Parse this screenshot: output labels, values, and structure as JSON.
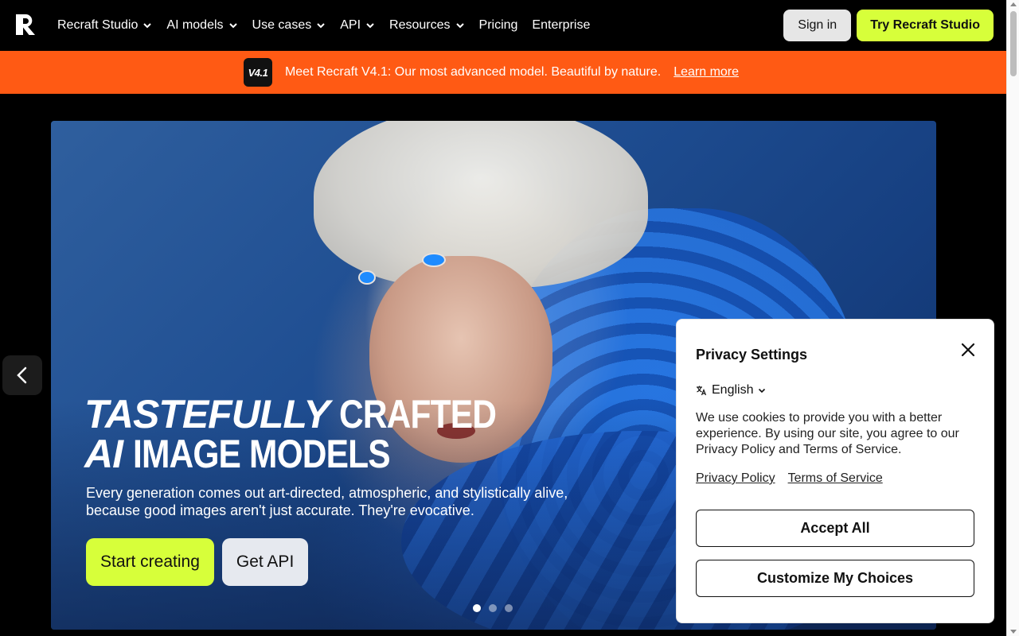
{
  "nav": {
    "items": [
      {
        "label": "Recraft Studio",
        "has_dropdown": true
      },
      {
        "label": "AI models",
        "has_dropdown": true
      },
      {
        "label": "Use cases",
        "has_dropdown": true
      },
      {
        "label": "API",
        "has_dropdown": true
      },
      {
        "label": "Resources",
        "has_dropdown": true
      },
      {
        "label": "Pricing",
        "has_dropdown": false
      },
      {
        "label": "Enterprise",
        "has_dropdown": false
      }
    ],
    "sign_in": "Sign in",
    "try_button": "Try Recraft Studio",
    "logo_icon": "recraft-logo-icon"
  },
  "banner": {
    "badge": "V4.1",
    "text": "Meet Recraft V4.1: Our most advanced model. Beautiful by nature.",
    "link": "Learn more",
    "color": "#ff5a14"
  },
  "hero": {
    "title_line1_italic": "TASTEFULLY",
    "title_line1_rest": "CRAFTED",
    "title_line2_italic": "AI",
    "title_line2_rest": "IMAGE MODELS",
    "subtitle": "Every generation comes out art-directed, atmospheric, and stylistically alive, because good images aren't just accurate. They're evocative.",
    "cta_primary": "Start creating",
    "cta_secondary": "Get API",
    "slides_total": 3,
    "active_slide": 1
  },
  "privacy": {
    "title": "Privacy Settings",
    "language": "English",
    "text": "We use cookies to provide you with a better experience. By using our site, you agree to our Privacy Policy and Terms of Service.",
    "link_policy": "Privacy Policy",
    "link_terms": "Terms of Service",
    "accept": "Accept All",
    "customize": "Customize My Choices"
  },
  "colors": {
    "accent": "#d7ff3a",
    "banner": "#ff5a14",
    "background": "#000000"
  }
}
